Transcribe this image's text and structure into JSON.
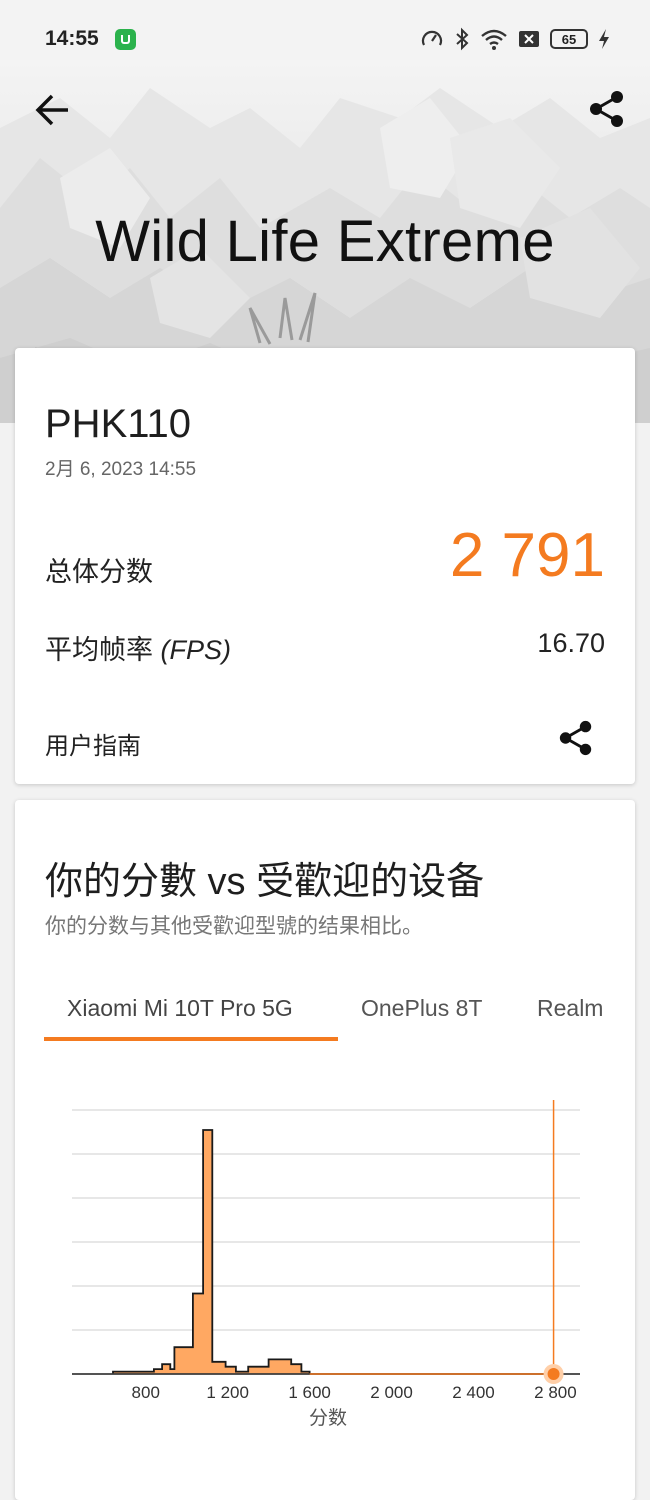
{
  "status_bar": {
    "time": "14:55",
    "icons": [
      "speedometer-icon",
      "bluetooth-icon",
      "wifi-icon",
      "close-box-icon"
    ],
    "battery": "65"
  },
  "header": {
    "title": "Wild Life Extreme",
    "back_icon": "arrow-left-icon",
    "share_icon": "share-icon"
  },
  "result": {
    "device": "PHK110",
    "date": "2月 6, 2023 14:55",
    "overall_label": "总体分数",
    "overall_score": "2 791",
    "fps_label": "平均帧率",
    "fps_unit": "(FPS)",
    "fps_value": "16.70",
    "guide_label": "用户指南"
  },
  "comparison": {
    "title": "你的分數 vs 受歡迎的设备",
    "subtitle": "你的分数与其他受歡迎型號的结果相比。",
    "tabs": [
      "Xiaomi Mi 10T Pro 5G",
      "OnePlus 8T",
      "Realm"
    ],
    "active_tab": 0
  },
  "colors": {
    "accent": "#f47b20",
    "histogram_fill": "#ffa862"
  },
  "chart_data": {
    "type": "area",
    "xlabel": "分数",
    "x_ticks": [
      800,
      1200,
      1600,
      2000,
      2400,
      2800
    ],
    "x_tick_labels": [
      "800",
      "1 200",
      "1 600",
      "2 000",
      "2 400",
      "2 800"
    ],
    "xlim": [
      440,
      2920
    ],
    "ylim": [
      0,
      100
    ],
    "y_gridlines": 6,
    "grid": true,
    "your_score": 2791,
    "histogram": [
      {
        "x": 440,
        "y": 0
      },
      {
        "x": 640,
        "y": 0
      },
      {
        "x": 640,
        "y": 1
      },
      {
        "x": 840,
        "y": 1
      },
      {
        "x": 840,
        "y": 2
      },
      {
        "x": 880,
        "y": 2
      },
      {
        "x": 880,
        "y": 4
      },
      {
        "x": 920,
        "y": 4
      },
      {
        "x": 920,
        "y": 2
      },
      {
        "x": 940,
        "y": 2
      },
      {
        "x": 940,
        "y": 11
      },
      {
        "x": 1030,
        "y": 11
      },
      {
        "x": 1030,
        "y": 33
      },
      {
        "x": 1080,
        "y": 33
      },
      {
        "x": 1080,
        "y": 100
      },
      {
        "x": 1125,
        "y": 100
      },
      {
        "x": 1125,
        "y": 5
      },
      {
        "x": 1190,
        "y": 5
      },
      {
        "x": 1190,
        "y": 3
      },
      {
        "x": 1240,
        "y": 3
      },
      {
        "x": 1240,
        "y": 1
      },
      {
        "x": 1300,
        "y": 1
      },
      {
        "x": 1300,
        "y": 3
      },
      {
        "x": 1400,
        "y": 3
      },
      {
        "x": 1400,
        "y": 6
      },
      {
        "x": 1510,
        "y": 6
      },
      {
        "x": 1510,
        "y": 4
      },
      {
        "x": 1560,
        "y": 4
      },
      {
        "x": 1560,
        "y": 1
      },
      {
        "x": 1600,
        "y": 1
      },
      {
        "x": 1600,
        "y": 0
      },
      {
        "x": 2920,
        "y": 0
      }
    ]
  }
}
